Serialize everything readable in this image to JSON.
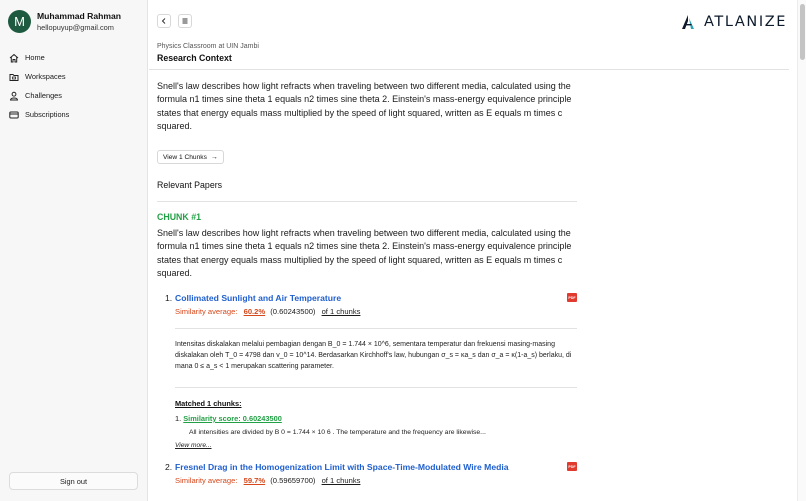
{
  "user": {
    "initial": "M",
    "name": "Muhammad Rahman",
    "email": "hellopuyup@gmail.com"
  },
  "nav": [
    {
      "label": "Home",
      "icon": "home-icon"
    },
    {
      "label": "Workspaces",
      "icon": "folder-icon"
    },
    {
      "label": "Challenges",
      "icon": "user-icon"
    },
    {
      "label": "Subscriptions",
      "icon": "card-icon"
    }
  ],
  "sign_out": "Sign out",
  "brand": {
    "name": "ATLANIZE",
    "color": "#0d1a2b"
  },
  "breadcrumb": "Physics Classroom at UIN Jambi",
  "page_title": "Research Context",
  "context_text": "Snell's law describes how light refracts when traveling between two different media, calculated using the formula n1 times sine theta 1 equals n2 times sine theta 2. Einstein's mass-energy equivalence principle states that energy equals mass multiplied by the speed of light squared, written as E equals m times c squared.",
  "view_chunks_label": "View 1 Chunks",
  "relevant_papers_title": "Relevant Papers",
  "chunk": {
    "title": "CHUNK #1",
    "text": "Snell's law describes how light refracts when traveling between two different media, calculated using the formula n1 times sine theta 1 equals n2 times sine theta 2. Einstein's mass-energy equivalence principle states that energy equals mass multiplied by the speed of light squared, written as E equals m times c squared."
  },
  "papers": [
    {
      "number": "1.",
      "title": "Collimated Sunlight and Air Temperature",
      "similarity_label": "Similarity average:",
      "similarity_pct": "60.2%",
      "similarity_raw": "(0.60243500)",
      "chunks_link": "of 1 chunks",
      "abstract": "Intensitas diskalakan melalui pembagian dengan B_0 = 1.744 × 10^6, sementara temperatur dan frekuensi masing-masing diskalakan oleh T_0 = 4798 dan v_0 = 10^14. Berdasarkan Kirchhoff's law, hubungan σ_s = κa_s dan σ_a = κ(1-a_s) berlaku, di mana 0 ≤ a_s < 1 merupakan scattering parameter.",
      "matched_title": "Matched 1 chunks:",
      "matched_num": "1.",
      "matched_score": "Similarity score: 0.60243500",
      "matched_text": "All intensities are divided by B 0 = 1.744 × 10 6 . The temperature and the frequency are likewise...",
      "view_more": "View more..."
    },
    {
      "number": "2.",
      "title": "Fresnel Drag in the Homogenization Limit with Space-Time-Modulated Wire Media",
      "similarity_label": "Similarity average:",
      "similarity_pct": "59.7%",
      "similarity_raw": "(0.59659700)",
      "chunks_link": "of 1 chunks"
    }
  ],
  "pdf_label": "PDF",
  "colors": {
    "accent_green": "#22a045",
    "link_blue": "#1f5fcf",
    "similarity_orange": "#d5481c",
    "pdf_red": "#e03b2e",
    "avatar_green": "#1e5a3f"
  }
}
